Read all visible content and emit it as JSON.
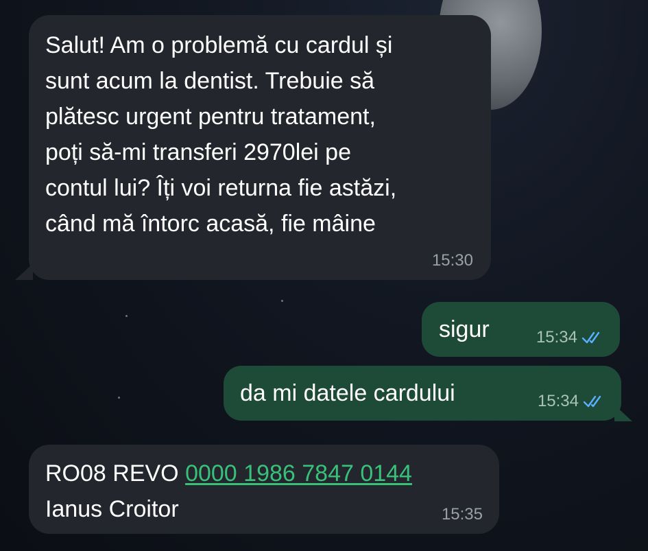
{
  "messages": [
    {
      "direction": "incoming",
      "text": "Salut! Am o problemă cu cardul și\nsunt acum la dentist. Trebuie să\nplătesc urgent pentru tratament,\npoți să-mi transferi 2970lei pe\ncontul lui? Îți voi returna fie astăzi,\ncând mă întorc acasă, fie mâine",
      "time": "15:30"
    },
    {
      "direction": "outgoing",
      "text": "sigur",
      "time": "15:34",
      "status_icon": "double-check-icon"
    },
    {
      "direction": "outgoing",
      "text": "da mi datele cardului",
      "time": "15:34",
      "status_icon": "double-check-icon"
    },
    {
      "direction": "incoming",
      "prefix": "RO08 REVO ",
      "link": "0000 1986 7847 0144",
      "line2": "Ianus Croitor",
      "time": "15:35"
    }
  ],
  "colors": {
    "incoming_bubble": "#23262c",
    "outgoing_bubble": "#1e4a38",
    "link": "#39c07a",
    "read_ticks": "#5ab0ff"
  }
}
